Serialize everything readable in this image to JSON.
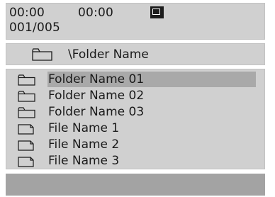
{
  "status": {
    "elapsed_time": "00:00",
    "total_time": "00:00",
    "track_counter": "001/005",
    "playback_state_icon": "stop-icon"
  },
  "path": {
    "current_folder": "\\Folder Name",
    "icon": "folder-icon"
  },
  "list": {
    "selected_index": 0,
    "items": [
      {
        "label": "Folder Name 01",
        "type": "folder",
        "icon": "folder-icon"
      },
      {
        "label": "Folder Name 02",
        "type": "folder",
        "icon": "folder-icon"
      },
      {
        "label": "Folder Name 03",
        "type": "folder",
        "icon": "folder-icon"
      },
      {
        "label": "File Name 1",
        "type": "file",
        "icon": "file-icon"
      },
      {
        "label": "File Name 2",
        "type": "file",
        "icon": "file-icon"
      },
      {
        "label": "File Name 3",
        "type": "file",
        "icon": "file-icon"
      }
    ]
  },
  "colors": {
    "panel_background": "#d0d0d0",
    "selection_highlight": "#a9a9a9",
    "bottom_bar": "#a3a3a3",
    "text": "#1a1a1a"
  }
}
